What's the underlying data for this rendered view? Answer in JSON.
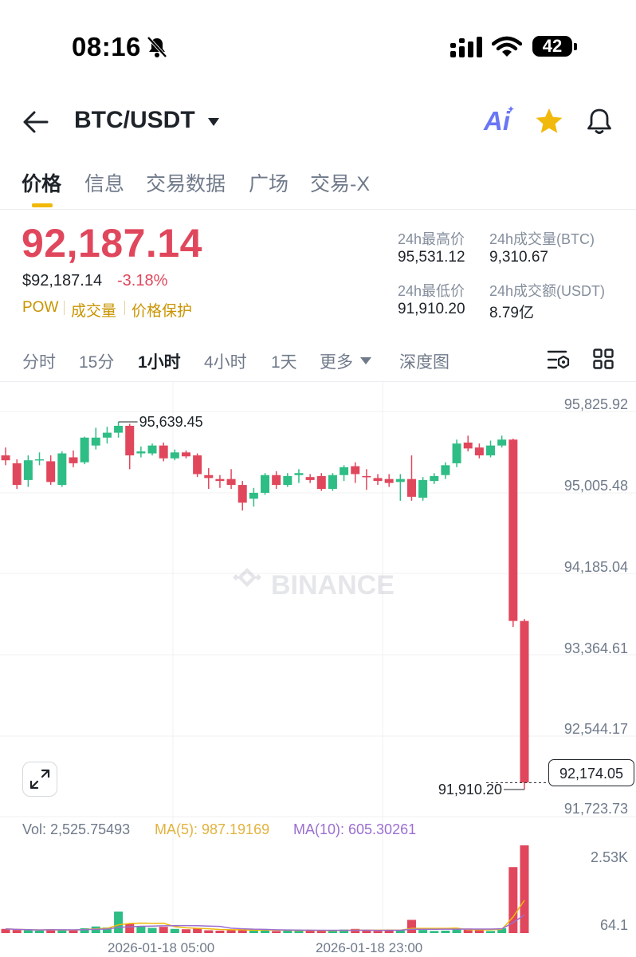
{
  "status_bar": {
    "time": "08:16",
    "battery": "42"
  },
  "header": {
    "pair": "BTC/USDT",
    "ai_label": "Ai"
  },
  "tabs": [
    "价格",
    "信息",
    "交易数据",
    "广场",
    "交易-X"
  ],
  "price": {
    "last": "92,187.14",
    "usd": "$92,187.14",
    "change": "-3.18%",
    "tags": [
      "POW",
      "成交量",
      "价格保护"
    ]
  },
  "stats": {
    "high_label": "24h最高价",
    "high_value": "95,531.12",
    "vol_btc_label": "24h成交量(BTC)",
    "vol_btc_value": "9,310.67",
    "low_label": "24h最低价",
    "low_value": "91,910.20",
    "vol_usdt_label": "24h成交额(USDT)",
    "vol_usdt_value": "8.79亿"
  },
  "intervals": [
    "分时",
    "15分",
    "1小时",
    "4小时",
    "1天",
    "更多",
    "深度图"
  ],
  "active_interval": "1小时",
  "chart": {
    "watermark": "BINANCE",
    "y_labels": [
      "95,825.92",
      "95,005.48",
      "94,185.04",
      "93,364.61",
      "92,544.17",
      "91,723.73"
    ],
    "high_marker": "95,639.45",
    "low_marker": "91,910.20",
    "current_price": "92,174.05",
    "vol_label": "Vol: 2,525.75493",
    "ma5_label": "MA(5): 987.19169",
    "ma10_label": "MA(10): 605.30261",
    "vol_y_labels": [
      "2.53K",
      "64.1"
    ],
    "x_labels": [
      "2026-01-18 05:00",
      "2026-01-18 23:00"
    ]
  },
  "chart_data": {
    "type": "candlestick",
    "interval": "1h",
    "up_color": "#2ebd85",
    "down_color": "#e0475c",
    "ma5_color": "#f0b90b",
    "ma10_color": "#9b6fd0",
    "ylim": [
      91723.73,
      95825.92
    ],
    "candles": [
      {
        "o": 95300,
        "c": 95250,
        "h": 95380,
        "l": 95200
      },
      {
        "o": 95220,
        "c": 95000,
        "h": 95260,
        "l": 94960
      },
      {
        "o": 95050,
        "c": 95250,
        "h": 95300,
        "l": 94980
      },
      {
        "o": 95250,
        "c": 95260,
        "h": 95330,
        "l": 95200
      },
      {
        "o": 95240,
        "c": 95030,
        "h": 95300,
        "l": 95000
      },
      {
        "o": 95000,
        "c": 95320,
        "h": 95340,
        "l": 94980
      },
      {
        "o": 95280,
        "c": 95220,
        "h": 95350,
        "l": 95180
      },
      {
        "o": 95230,
        "c": 95480,
        "h": 95490,
        "l": 95210
      },
      {
        "o": 95400,
        "c": 95480,
        "h": 95580,
        "l": 95360
      },
      {
        "o": 95480,
        "c": 95530,
        "h": 95590,
        "l": 95420
      },
      {
        "o": 95530,
        "c": 95600,
        "h": 95639.45,
        "l": 95480
      },
      {
        "o": 95600,
        "c": 95300,
        "h": 95620,
        "l": 95160
      },
      {
        "o": 95320,
        "c": 95340,
        "h": 95390,
        "l": 95280
      },
      {
        "o": 95320,
        "c": 95400,
        "h": 95420,
        "l": 95300
      },
      {
        "o": 95400,
        "c": 95270,
        "h": 95430,
        "l": 95240
      },
      {
        "o": 95270,
        "c": 95330,
        "h": 95360,
        "l": 95250
      },
      {
        "o": 95330,
        "c": 95290,
        "h": 95350,
        "l": 95270
      },
      {
        "o": 95300,
        "c": 95110,
        "h": 95320,
        "l": 95080
      },
      {
        "o": 95100,
        "c": 95070,
        "h": 95170,
        "l": 94960
      },
      {
        "o": 95060,
        "c": 95040,
        "h": 95100,
        "l": 94970
      },
      {
        "o": 95060,
        "c": 95000,
        "h": 95160,
        "l": 94960
      },
      {
        "o": 95000,
        "c": 94820,
        "h": 95040,
        "l": 94740
      },
      {
        "o": 94860,
        "c": 94920,
        "h": 94970,
        "l": 94780
      },
      {
        "o": 94920,
        "c": 95100,
        "h": 95120,
        "l": 94900
      },
      {
        "o": 95100,
        "c": 95000,
        "h": 95140,
        "l": 94960
      },
      {
        "o": 95000,
        "c": 95090,
        "h": 95120,
        "l": 94980
      },
      {
        "o": 95100,
        "c": 95120,
        "h": 95160,
        "l": 95020
      },
      {
        "o": 95080,
        "c": 95050,
        "h": 95110,
        "l": 95020
      },
      {
        "o": 95090,
        "c": 94960,
        "h": 95120,
        "l": 94940
      },
      {
        "o": 94960,
        "c": 95100,
        "h": 95120,
        "l": 94940
      },
      {
        "o": 95100,
        "c": 95180,
        "h": 95200,
        "l": 95040
      },
      {
        "o": 95190,
        "c": 95110,
        "h": 95230,
        "l": 95020
      },
      {
        "o": 95090,
        "c": 95080,
        "h": 95160,
        "l": 94950
      },
      {
        "o": 95070,
        "c": 95040,
        "h": 95110,
        "l": 95000
      },
      {
        "o": 95060,
        "c": 95020,
        "h": 95110,
        "l": 94980
      },
      {
        "o": 95030,
        "c": 95060,
        "h": 95110,
        "l": 94840
      },
      {
        "o": 95060,
        "c": 94880,
        "h": 95300,
        "l": 94840
      },
      {
        "o": 94870,
        "c": 95050,
        "h": 95080,
        "l": 94840
      },
      {
        "o": 95040,
        "c": 95090,
        "h": 95120,
        "l": 95010
      },
      {
        "o": 95100,
        "c": 95200,
        "h": 95230,
        "l": 95060
      },
      {
        "o": 95220,
        "c": 95420,
        "h": 95460,
        "l": 95180
      },
      {
        "o": 95430,
        "c": 95370,
        "h": 95500,
        "l": 95340
      },
      {
        "o": 95380,
        "c": 95300,
        "h": 95420,
        "l": 95270
      },
      {
        "o": 95300,
        "c": 95400,
        "h": 95450,
        "l": 95280
      },
      {
        "o": 95400,
        "c": 95460,
        "h": 95500,
        "l": 95380
      },
      {
        "o": 95460,
        "c": 93620,
        "h": 95470,
        "l": 93560
      },
      {
        "o": 93620,
        "c": 91980,
        "h": 93640,
        "l": 91910.2
      }
    ],
    "volume": [
      120,
      90,
      80,
      70,
      110,
      100,
      80,
      140,
      190,
      160,
      620,
      270,
      200,
      150,
      180,
      120,
      110,
      130,
      80,
      70,
      90,
      110,
      70,
      100,
      60,
      70,
      80,
      90,
      60,
      60,
      100,
      120,
      80,
      60,
      70,
      80,
      380,
      90,
      60,
      70,
      120,
      130,
      90,
      60,
      140,
      1900,
      2525.75
    ]
  }
}
